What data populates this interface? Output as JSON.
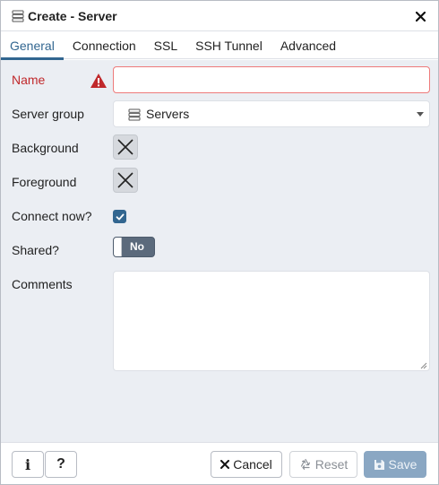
{
  "dialog": {
    "title": "Create - Server",
    "title_icon": "server-icon",
    "close_icon": "close-icon"
  },
  "tabs": [
    {
      "label": "General",
      "active": true
    },
    {
      "label": "Connection",
      "active": false
    },
    {
      "label": "SSL",
      "active": false
    },
    {
      "label": "SSH Tunnel",
      "active": false
    },
    {
      "label": "Advanced",
      "active": false
    }
  ],
  "form": {
    "name": {
      "label": "Name",
      "value": "",
      "error": true
    },
    "server_group": {
      "label": "Server group",
      "value": "Servers"
    },
    "background": {
      "label": "Background"
    },
    "foreground": {
      "label": "Foreground"
    },
    "connect_now": {
      "label": "Connect now?",
      "checked": true
    },
    "shared": {
      "label": "Shared?",
      "value": "No"
    },
    "comments": {
      "label": "Comments",
      "value": ""
    }
  },
  "footer": {
    "info_label": "i",
    "help_label": "?",
    "cancel_label": "Cancel",
    "reset_label": "Reset",
    "save_label": "Save"
  },
  "colors": {
    "accent": "#326690",
    "error": "#c0282b",
    "body_bg": "#ebeef3",
    "save_disabled": "#8aa7c3"
  }
}
